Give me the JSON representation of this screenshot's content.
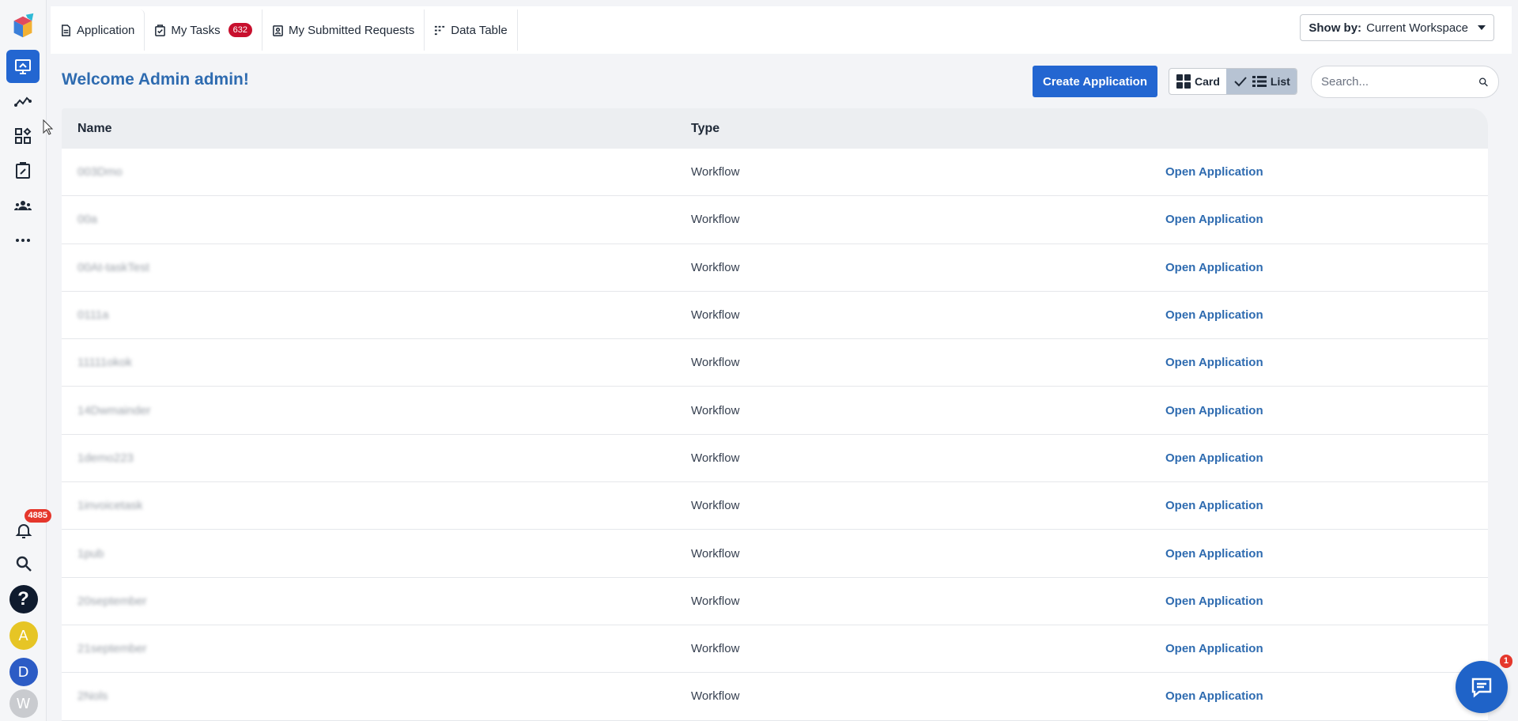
{
  "tabs": [
    {
      "label": "Application",
      "icon": "document-icon"
    },
    {
      "label": "My Tasks",
      "icon": "clipboard-icon",
      "badge": "632"
    },
    {
      "label": "My Submitted Requests",
      "icon": "request-icon"
    },
    {
      "label": "Data Table",
      "icon": "table-icon"
    }
  ],
  "showby": {
    "label": "Show by:",
    "value": "Current Workspace"
  },
  "welcome": "Welcome Admin admin!",
  "create_button": "Create Application",
  "view_toggle": {
    "card": "Card",
    "list": "List"
  },
  "search": {
    "placeholder": "Search..."
  },
  "table": {
    "headers": {
      "name": "Name",
      "type": "Type"
    },
    "rows": [
      {
        "name": "003Dmo",
        "type": "Workflow",
        "action": "Open Application"
      },
      {
        "name": "00a",
        "type": "Workflow",
        "action": "Open Application"
      },
      {
        "name": "00At-taskTest",
        "type": "Workflow",
        "action": "Open Application"
      },
      {
        "name": "0111a",
        "type": "Workflow",
        "action": "Open Application"
      },
      {
        "name": "11111okok",
        "type": "Workflow",
        "action": "Open Application"
      },
      {
        "name": "14Dwmainder",
        "type": "Workflow",
        "action": "Open Application"
      },
      {
        "name": "1demo223",
        "type": "Workflow",
        "action": "Open Application"
      },
      {
        "name": "1invoicetask",
        "type": "Workflow",
        "action": "Open Application"
      },
      {
        "name": "1pub",
        "type": "Workflow",
        "action": "Open Application"
      },
      {
        "name": "20september",
        "type": "Workflow",
        "action": "Open Application"
      },
      {
        "name": "21september",
        "type": "Workflow",
        "action": "Open Application"
      },
      {
        "name": "2Nols",
        "type": "Workflow",
        "action": "Open Application"
      }
    ]
  },
  "sidebar": {
    "notifications_badge": "4885",
    "help": "?",
    "avatars": [
      "A",
      "D",
      "W"
    ]
  },
  "chat_badge": "1",
  "colors": {
    "accent": "#2366d1",
    "link": "#2e6bb0",
    "badge": "#e5372c"
  }
}
